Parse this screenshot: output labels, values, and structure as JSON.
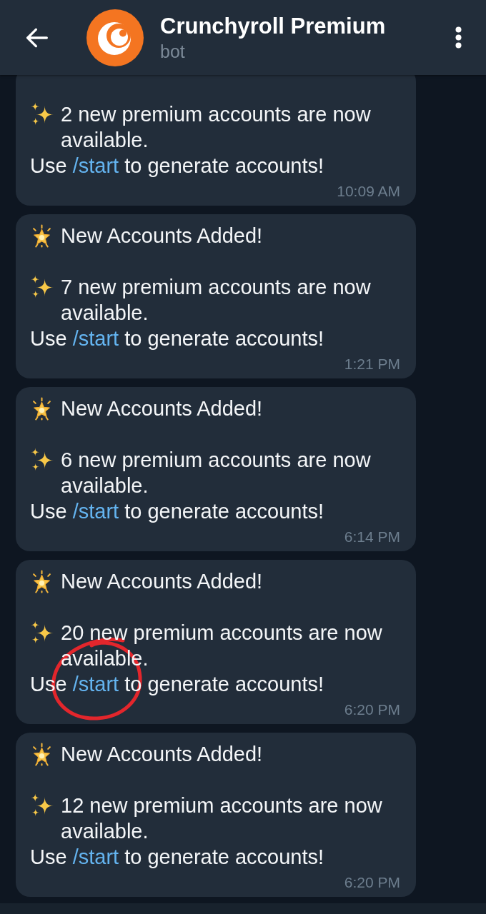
{
  "header": {
    "title": "Crunchyroll Premium",
    "subtitle": "bot"
  },
  "messages": [
    {
      "announcement": "2 new premium accounts are now available.",
      "prompt_before": "Use",
      "command": "/start",
      "prompt_after": "to generate accounts!",
      "time": "10:09 AM",
      "circled": false
    },
    {
      "title": "New Accounts Added!",
      "announcement": "7 new premium accounts are now available.",
      "prompt_before": "Use",
      "command": "/start",
      "prompt_after": "to generate accounts!",
      "time": "1:21 PM",
      "circled": false
    },
    {
      "title": "New Accounts Added!",
      "announcement": "6 new premium accounts are now available.",
      "prompt_before": "Use",
      "command": "/start",
      "prompt_after": "to generate accounts!",
      "time": "6:14 PM",
      "circled": false
    },
    {
      "title": "New Accounts Added!",
      "announcement": "20 new premium accounts are now available.",
      "prompt_before": "Use",
      "command": "/start",
      "prompt_after": "to generate accounts!",
      "time": "6:20 PM",
      "circled": true
    },
    {
      "title": "New Accounts Added!",
      "announcement": "12 new premium accounts are now available.",
      "prompt_before": "Use",
      "command": "/start",
      "prompt_after": "to generate accounts!",
      "time": "6:20 PM",
      "circled": false
    }
  ]
}
